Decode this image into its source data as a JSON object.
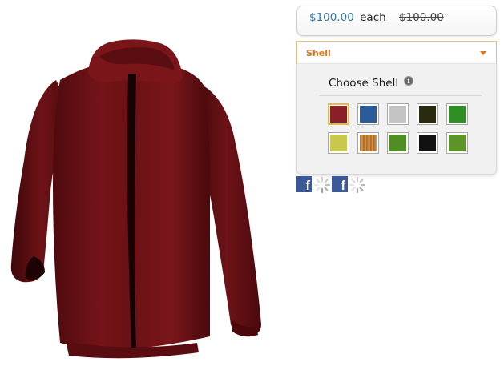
{
  "product": {
    "image_alt": "jacket-product-image",
    "shell_color": "#6a1216"
  },
  "pricing": {
    "price": "$100.00",
    "unit": "each",
    "original_price": "$100.00"
  },
  "shell_select": {
    "label": "Shell",
    "accent_color": "#d9741a"
  },
  "shell_panel": {
    "title": "Choose Shell",
    "info_icon": "i",
    "swatches": [
      {
        "name": "dark-red",
        "color": "#8b1f27",
        "selected": true
      },
      {
        "name": "blue",
        "color": "#2a5c9a",
        "selected": false
      },
      {
        "name": "light-gray",
        "color": "#c4c4c4",
        "selected": false
      },
      {
        "name": "dark-olive",
        "color": "#2a2a0e",
        "selected": false
      },
      {
        "name": "green",
        "color": "#2f8f24",
        "selected": false
      },
      {
        "name": "yellow-green",
        "color": "#c9c84c",
        "selected": false
      },
      {
        "name": "wood",
        "color": "#c07f38",
        "selected": false
      },
      {
        "name": "grass-green",
        "color": "#4f8e22",
        "selected": false
      },
      {
        "name": "black",
        "color": "#111111",
        "selected": false
      },
      {
        "name": "olive-green",
        "color": "#5d9427",
        "selected": false
      }
    ]
  },
  "social": {
    "facebook_icon": "f",
    "share_icons": [
      "facebook-icon",
      "loading-spinner-icon",
      "facebook-icon",
      "loading-spinner-icon"
    ]
  }
}
